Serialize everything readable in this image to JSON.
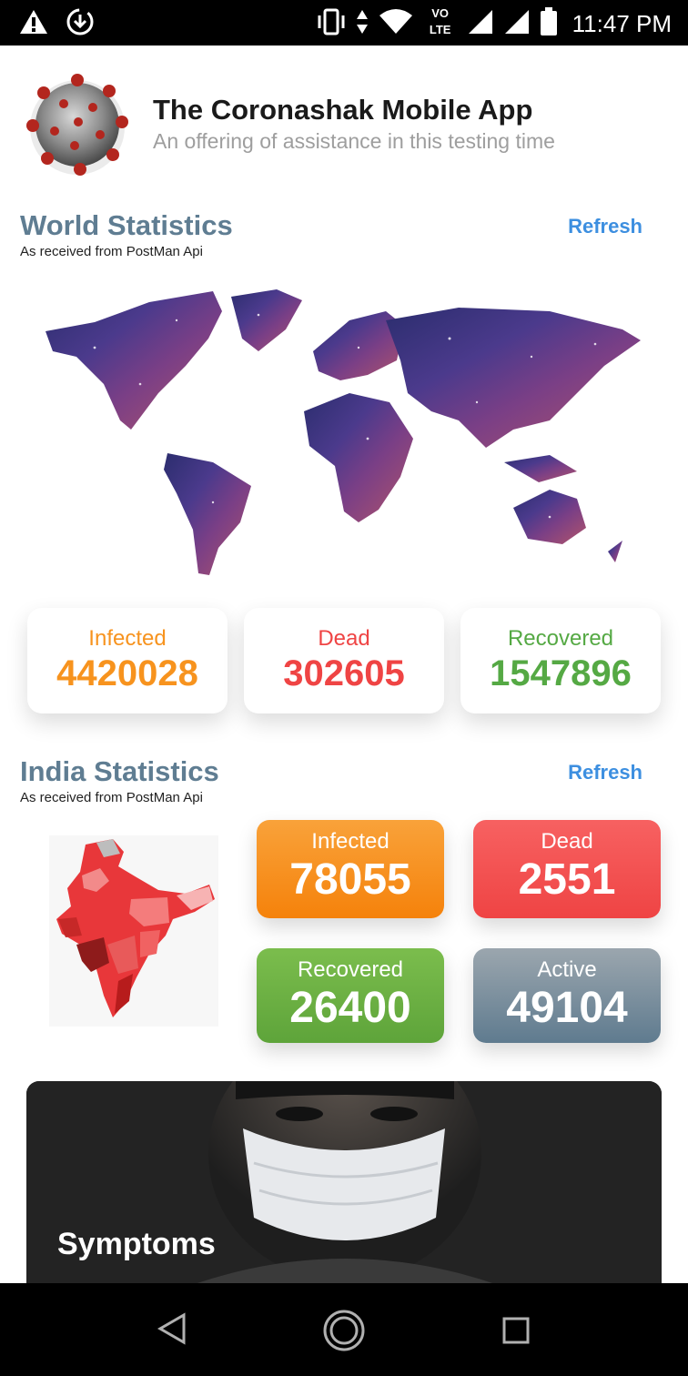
{
  "status_bar": {
    "time": "11:47 PM",
    "network_label": "VO LTE",
    "icons": [
      "warning-icon",
      "download-icon",
      "vibrate-icon",
      "data-arrows-icon",
      "wifi-icon",
      "lte-icon",
      "signal-icon",
      "signal-icon",
      "battery-icon"
    ]
  },
  "header": {
    "title": "The Coronashak Mobile App",
    "subtitle": "An offering of assistance in this testing time"
  },
  "world": {
    "title": "World Statistics",
    "subtitle": "As received from PostMan Api",
    "refresh_label": "Refresh",
    "stats": {
      "infected_label": "Infected",
      "infected_value": "4420028",
      "dead_label": "Dead",
      "dead_value": "302605",
      "recovered_label": "Recovered",
      "recovered_value": "1547896"
    }
  },
  "india": {
    "title": "India Statistics",
    "subtitle": "As received from PostMan Api",
    "refresh_label": "Refresh",
    "stats": {
      "infected_label": "Infected",
      "infected_value": "78055",
      "dead_label": "Dead",
      "dead_value": "2551",
      "recovered_label": "Recovered",
      "recovered_value": "26400",
      "active_label": "Active",
      "active_value": "49104"
    }
  },
  "symptoms": {
    "label": "Symptoms"
  },
  "nav_bar": {
    "icons": [
      "back-icon",
      "home-icon",
      "recents-icon"
    ]
  },
  "colors": {
    "infected": "#f7931e",
    "dead": "#ef4444",
    "recovered": "#55a944",
    "section_title": "#5f7d92",
    "refresh": "#3d8fe0"
  }
}
